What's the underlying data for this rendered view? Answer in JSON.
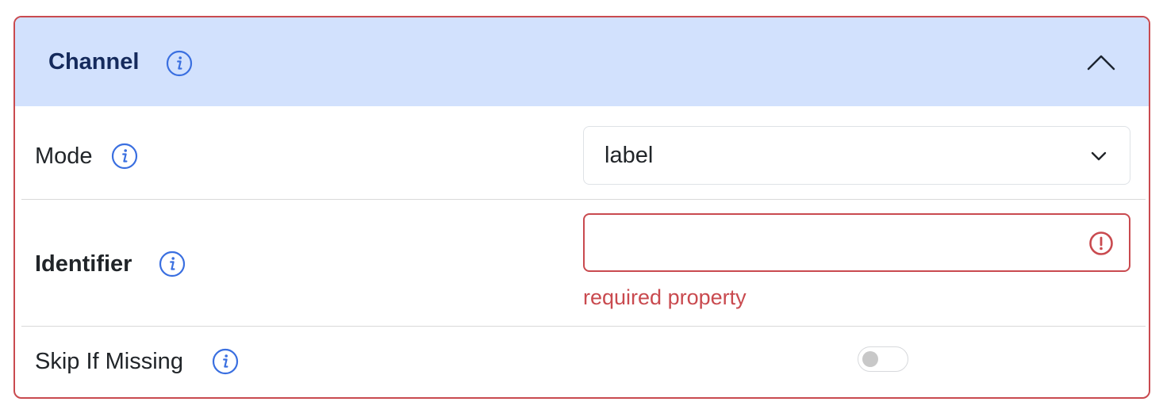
{
  "panel": {
    "title": "Channel",
    "title_icon": "info-icon",
    "collapse_icon": "chevron-up-icon",
    "collapsed": false
  },
  "fields": {
    "mode": {
      "label": "Mode",
      "icon": "info-icon",
      "value": "label",
      "dropdown_icon": "chevron-down-icon"
    },
    "identifier": {
      "label": "Identifier",
      "icon": "info-icon",
      "value": "",
      "error_icon": "exclamation-circle-icon",
      "error": "required property",
      "required": true
    },
    "skip_if_missing": {
      "label": "Skip If Missing",
      "icon": "info-icon",
      "enabled": false
    }
  },
  "colors": {
    "header_bg": "#d2e1fd",
    "title_text": "#152a5c",
    "info_icon": "#3a6fe0",
    "error": "#c94a4f",
    "border_error": "#c94a4f"
  }
}
